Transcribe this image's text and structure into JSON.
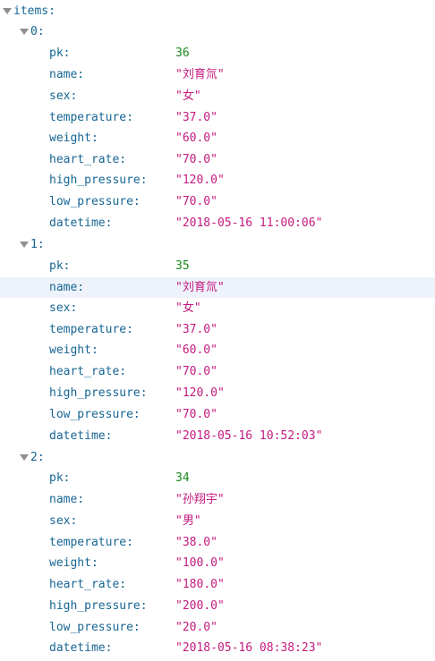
{
  "root_key": "items:",
  "items": [
    {
      "index_label": "0:",
      "fields": [
        {
          "key": "pk:",
          "value": "36",
          "type": "num"
        },
        {
          "key": "name:",
          "value": "\"刘育氚\"",
          "type": "str"
        },
        {
          "key": "sex:",
          "value": "\"女\"",
          "type": "str"
        },
        {
          "key": "temperature:",
          "value": "\"37.0\"",
          "type": "str"
        },
        {
          "key": "weight:",
          "value": "\"60.0\"",
          "type": "str"
        },
        {
          "key": "heart_rate:",
          "value": "\"70.0\"",
          "type": "str"
        },
        {
          "key": "high_pressure:",
          "value": "\"120.0\"",
          "type": "str"
        },
        {
          "key": "low_pressure:",
          "value": "\"70.0\"",
          "type": "str"
        },
        {
          "key": "datetime:",
          "value": "\"2018-05-16 11:00:06\"",
          "type": "str"
        }
      ]
    },
    {
      "index_label": "1:",
      "fields": [
        {
          "key": "pk:",
          "value": "35",
          "type": "num"
        },
        {
          "key": "name:",
          "value": "\"刘育氚\"",
          "type": "str"
        },
        {
          "key": "sex:",
          "value": "\"女\"",
          "type": "str"
        },
        {
          "key": "temperature:",
          "value": "\"37.0\"",
          "type": "str"
        },
        {
          "key": "weight:",
          "value": "\"60.0\"",
          "type": "str"
        },
        {
          "key": "heart_rate:",
          "value": "\"70.0\"",
          "type": "str"
        },
        {
          "key": "high_pressure:",
          "value": "\"120.0\"",
          "type": "str"
        },
        {
          "key": "low_pressure:",
          "value": "\"70.0\"",
          "type": "str"
        },
        {
          "key": "datetime:",
          "value": "\"2018-05-16 10:52:03\"",
          "type": "str"
        }
      ]
    },
    {
      "index_label": "2:",
      "fields": [
        {
          "key": "pk:",
          "value": "34",
          "type": "num"
        },
        {
          "key": "name:",
          "value": "\"孙翔宇\"",
          "type": "str"
        },
        {
          "key": "sex:",
          "value": "\"男\"",
          "type": "str"
        },
        {
          "key": "temperature:",
          "value": "\"38.0\"",
          "type": "str"
        },
        {
          "key": "weight:",
          "value": "\"100.0\"",
          "type": "str"
        },
        {
          "key": "heart_rate:",
          "value": "\"180.0\"",
          "type": "str"
        },
        {
          "key": "high_pressure:",
          "value": "\"200.0\"",
          "type": "str"
        },
        {
          "key": "low_pressure:",
          "value": "\"20.0\"",
          "type": "str"
        },
        {
          "key": "datetime:",
          "value": "\"2018-05-16 08:38:23\"",
          "type": "str"
        }
      ]
    }
  ],
  "colors": {
    "key": "#176693",
    "string": "#c41a7f",
    "number": "#1a8a1a",
    "highlight": "#eef3fb",
    "toggle": "#8f8f8f"
  },
  "icons": {
    "toggle": "triangle-down-icon"
  }
}
